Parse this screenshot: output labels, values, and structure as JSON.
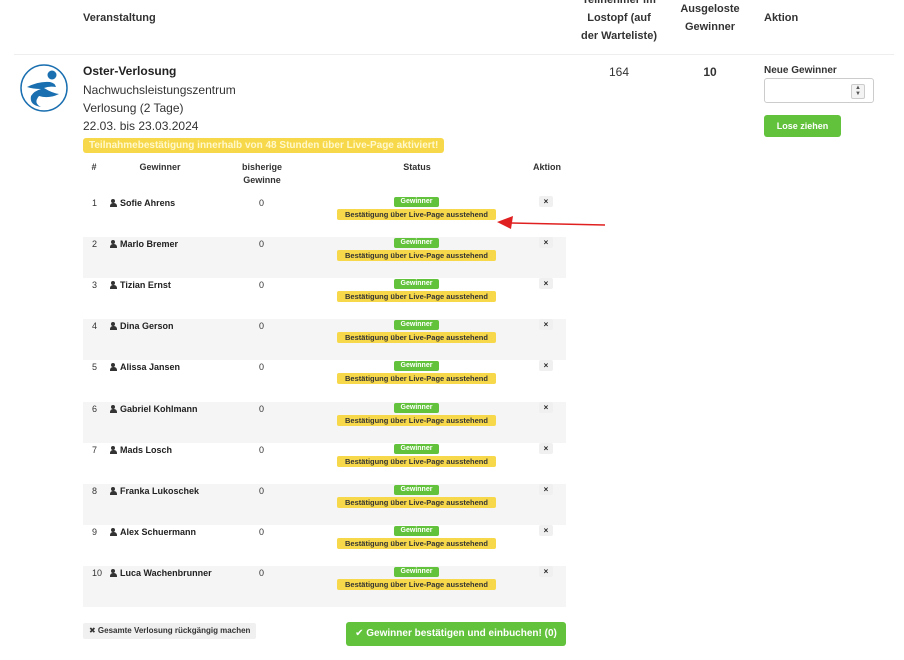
{
  "header": {
    "veranstaltung": "Veranstaltung",
    "teilnehmer_line1": "Teilnehmer im",
    "teilnehmer_line2": "Lostopf (auf",
    "teilnehmer_line3": "der Warteliste)",
    "ausgeloste_line1": "Ausgeloste",
    "ausgeloste_line2": "Gewinner",
    "aktion": "Aktion"
  },
  "event": {
    "title": "Oster-Verlosung",
    "organizer": "Nachwuchsleistungszentrum",
    "type": "Verlosung (2 Tage)",
    "dates": "22.03. bis 23.03.2024",
    "notice": "Teilnahmebestätigung innerhalb von 48 Stunden über Live-Page aktiviert!",
    "participants": "164",
    "winners_count": "10"
  },
  "action": {
    "neue_gewinner_label": "Neue Gewinner",
    "neue_gewinner_value": "",
    "spinner_up": "▲",
    "spinner_down": "▼",
    "lose_ziehen": "Lose ziehen"
  },
  "winners_table": {
    "col_num": "#",
    "col_winner": "Gewinner",
    "col_prev_line1": "bisherige",
    "col_prev_line2": "Gewinne",
    "col_status": "Status",
    "col_action": "Aktion",
    "status_winner": "Gewinner",
    "status_pending": "Bestätigung über Live-Page ausstehend",
    "remove_icon": "×",
    "rows": [
      {
        "num": "1",
        "name": "Sofie Ahrens",
        "wins": "0"
      },
      {
        "num": "2",
        "name": "Marlo Bremer",
        "wins": "0"
      },
      {
        "num": "3",
        "name": "Tizian Ernst",
        "wins": "0"
      },
      {
        "num": "4",
        "name": "Dina Gerson",
        "wins": "0"
      },
      {
        "num": "5",
        "name": "Alissa Jansen",
        "wins": "0"
      },
      {
        "num": "6",
        "name": "Gabriel Kohlmann",
        "wins": "0"
      },
      {
        "num": "7",
        "name": "Mads Losch",
        "wins": "0"
      },
      {
        "num": "8",
        "name": "Franka Lukoschek",
        "wins": "0"
      },
      {
        "num": "9",
        "name": "Alex Schuermann",
        "wins": "0"
      },
      {
        "num": "10",
        "name": "Luca Wachenbrunner",
        "wins": "0"
      }
    ]
  },
  "footer": {
    "undo_label": "✖ Gesamte Verlosung rückgängig machen",
    "confirm_label": "✔ Gewinner bestätigen und einbuchen! (0)"
  },
  "colors": {
    "green": "#62c23c",
    "yellow": "#f7d84a",
    "arrow": "#e02020",
    "logo_blue": "#1a6fb0"
  }
}
